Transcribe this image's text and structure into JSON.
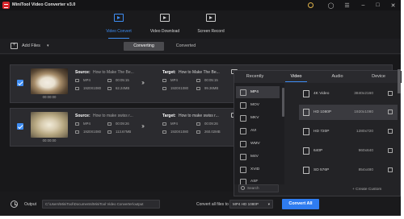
{
  "window": {
    "title": "MiniTool Video Converter v3.0"
  },
  "nav": {
    "items": [
      {
        "label": "Video Convert",
        "icon": "video-convert-icon",
        "active": true
      },
      {
        "label": "Video Download",
        "icon": "video-download-icon",
        "active": false
      },
      {
        "label": "Screen Record",
        "icon": "screen-record-icon",
        "active": false
      }
    ]
  },
  "toolbar": {
    "add_files_label": "Add Files",
    "tabs": [
      {
        "label": "Converting",
        "active": true
      },
      {
        "label": "Converted",
        "active": false
      }
    ]
  },
  "tasks": [
    {
      "source_label": "Source:",
      "source_name": "How to Make The Be...",
      "source_format": "MP4",
      "source_duration": "00:05:15",
      "source_resolution": "1920X1080",
      "source_size": "62.24MB",
      "target_label": "Target:",
      "target_name": "How to Make The Be...",
      "target_format": "MP4",
      "target_duration": "00:05:15",
      "target_resolution": "1920X1080",
      "target_size": "99.36MB",
      "thumb_time": "00:00:00"
    },
    {
      "source_label": "Source:",
      "source_name": "How to make swiss r...",
      "source_format": "MP4",
      "source_duration": "00:09:26",
      "source_resolution": "1920X1080",
      "source_size": "113.67MB",
      "target_label": "Target:",
      "target_name": "How to make swiss r...",
      "target_format": "MP4",
      "target_duration": "00:09:26",
      "target_resolution": "1920X1080",
      "target_size": "260.02MB",
      "thumb_time": "00:00:00"
    }
  ],
  "format_popup": {
    "tabs": [
      {
        "label": "Recently",
        "active": false
      },
      {
        "label": "Video",
        "active": true
      },
      {
        "label": "Audio",
        "active": false
      },
      {
        "label": "Device",
        "active": false
      }
    ],
    "formats": [
      "MP4",
      "MOV",
      "MKV",
      "AVI",
      "WMV",
      "M4V",
      "XVID",
      "ASF"
    ],
    "selected_format": "MP4",
    "search_placeholder": "Search",
    "resolutions": [
      {
        "name": "4K Video",
        "dimensions": "3840x2160"
      },
      {
        "name": "HD 1080P",
        "dimensions": "1920x1080",
        "selected": true
      },
      {
        "name": "HD 720P",
        "dimensions": "1280x720"
      },
      {
        "name": "640P",
        "dimensions": "960x640"
      },
      {
        "name": "SD 576P",
        "dimensions": "854x480"
      }
    ],
    "create_custom_label": "+ Create Custom"
  },
  "bottom": {
    "output_label": "Output",
    "output_path": "C:\\Users\\MiniTool\\Documents\\MiniTool Video Converter\\output",
    "convert_all_files_label": "Convert all files to",
    "convert_all_files_value": "MP4 HD 1080P",
    "convert_all_button": "Convert All"
  },
  "colors": {
    "accent": "#3e8df3",
    "button": "#2f7cf0",
    "brand_red": "#d8262c"
  }
}
